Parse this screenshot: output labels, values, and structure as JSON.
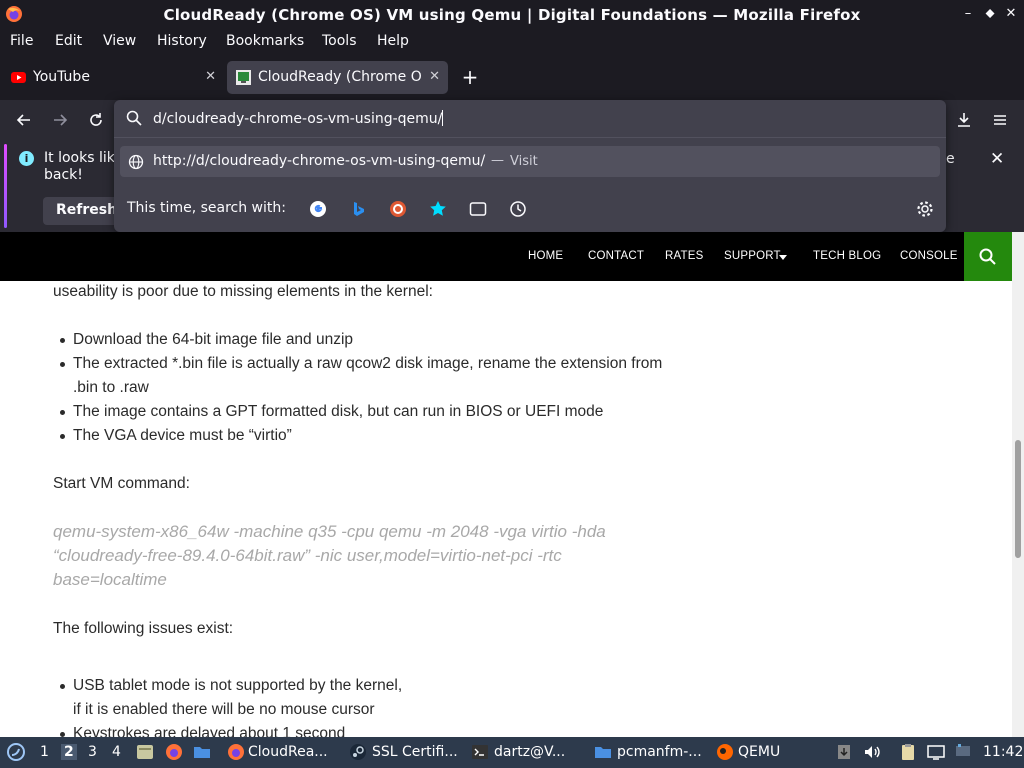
{
  "window": {
    "title": "CloudReady (Chrome OS) VM using Qemu | Digital Foundations — Mozilla Firefox",
    "controls": [
      "–",
      "⬥",
      "✕"
    ]
  },
  "menu": [
    "File",
    "Edit",
    "View",
    "History",
    "Bookmarks",
    "Tools",
    "Help"
  ],
  "tabs": [
    {
      "label": "YouTube",
      "close": "✕"
    },
    {
      "label": "CloudReady (Chrome OS",
      "close": "✕"
    }
  ],
  "newtab": "+",
  "urlbar": {
    "value": "d/cloudready-chrome-os-vm-using-qemu/",
    "suggestion_url": "http://d/cloudready-chrome-os-vm-using-qemu/",
    "suggestion_sep": "—",
    "suggestion_action": "Visit",
    "search_with": "This time, search with:"
  },
  "notification": {
    "message": "It looks like back!",
    "message_line1": "It looks like",
    "message_line2": "back!",
    "button": "Refresh",
    "trailing": "e",
    "close": "✕"
  },
  "site_nav": [
    "HOME",
    "CONTACT",
    "RATES",
    "SUPPORT",
    "TECH BLOG",
    "CONSOLE"
  ],
  "content": {
    "intro": "useability is poor due to missing elements in the kernel:",
    "steps": [
      "Download the 64-bit image file and unzip",
      "The extracted *.bin file is actually a raw qcow2 disk image, rename the extension from",
      ".bin to .raw",
      "The image contains a GPT formatted disk, but can run in BIOS or UEFI mode",
      "The VGA device must be “virtio”"
    ],
    "start_label": "Start VM command:",
    "command_lines": [
      "qemu-system-x86_64w -machine q35 -cpu qemu -m 2048 -vga virtio -hda",
      "“cloudready-free-89.4.0-64bit.raw” -nic user,model=virtio-net-pci -rtc",
      "base=localtime"
    ],
    "issues_label": "The following issues exist:",
    "issues": [
      "USB tablet mode is not supported by the kernel,",
      "if it is enabled there will be no mouse cursor",
      "Keystrokes are delayed about 1 second"
    ]
  },
  "taskbar": {
    "workspaces": [
      "1",
      "2",
      "3",
      "4"
    ],
    "active_workspace": "2",
    "tasks": [
      "CloudRea...",
      "SSL Certifi...",
      "dartz@V...",
      "pcmanfm-...",
      "QEMU"
    ],
    "clock": "11:42"
  },
  "colors": {
    "accent_green": "#24890d",
    "firefox_dark": "#1c1b22",
    "taskbar": "#2d3a4c"
  }
}
